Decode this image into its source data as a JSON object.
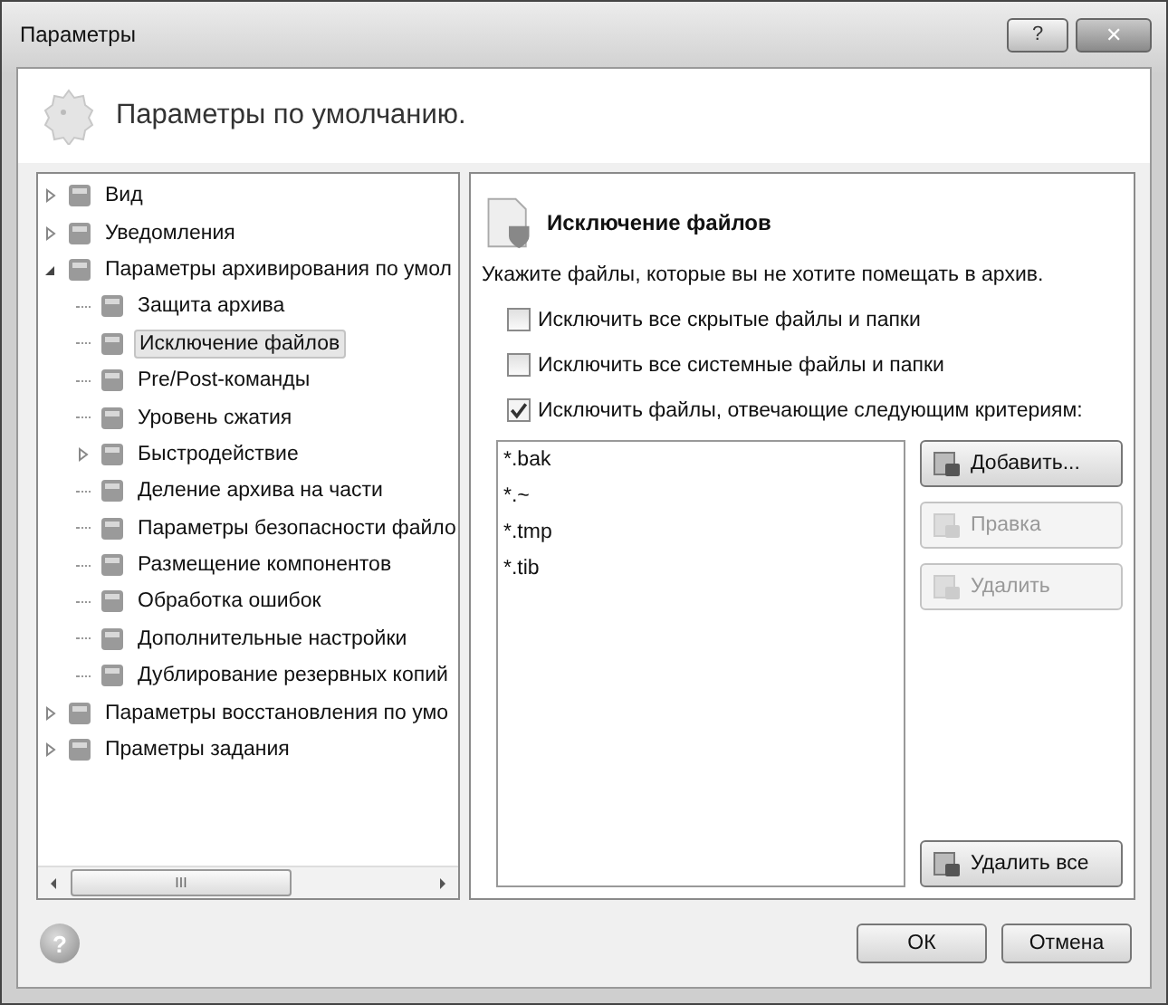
{
  "window": {
    "title": "Параметры",
    "help_button": "?",
    "close_button": "✕"
  },
  "header": {
    "title": "Параметры по умолчанию."
  },
  "tree": [
    {
      "label": "Вид",
      "expanded": false,
      "selected": false
    },
    {
      "label": "Уведомления",
      "expanded": false,
      "selected": false
    },
    {
      "label": "Параметры архивирования по умол",
      "expanded": true,
      "selected": false,
      "children": [
        {
          "label": "Защита архива",
          "selected": false
        },
        {
          "label": "Исключение файлов",
          "selected": true
        },
        {
          "label": "Pre/Post-команды",
          "selected": false
        },
        {
          "label": "Уровень сжатия",
          "selected": false
        },
        {
          "label": "Быстродействие",
          "expanded": false,
          "selected": false
        },
        {
          "label": "Деление архива на части",
          "selected": false
        },
        {
          "label": "Параметры безопасности файло",
          "selected": false
        },
        {
          "label": "Размещение компонентов",
          "selected": false
        },
        {
          "label": "Обработка ошибок",
          "selected": false
        },
        {
          "label": "Дополнительные настройки",
          "selected": false
        },
        {
          "label": "Дублирование резервных копий",
          "selected": false
        }
      ]
    },
    {
      "label": "Параметры восстановления по умо",
      "expanded": false,
      "selected": false
    },
    {
      "label": "Праметры задания",
      "expanded": false,
      "selected": false
    }
  ],
  "scrollbar_grip": "III",
  "panel": {
    "title": "Исключение файлов",
    "description": "Укажите файлы, которые вы не хотите помещать в архив.",
    "options": [
      {
        "label": "Исключить все скрытые файлы и папки",
        "checked": false
      },
      {
        "label": "Исключить все системные файлы и папки",
        "checked": false
      },
      {
        "label": "Исключить файлы, отвечающие следующим критериям:",
        "checked": true
      }
    ],
    "masks": [
      "*.bak",
      "*.~",
      "*.tmp",
      "*.tib"
    ],
    "buttons": [
      {
        "label": "Добавить...",
        "disabled": false
      },
      {
        "label": "Правка",
        "disabled": true
      },
      {
        "label": "Удалить",
        "disabled": true
      },
      {
        "label": "Удалить все",
        "disabled": false
      }
    ]
  },
  "footer": {
    "help": "?",
    "buttons": [
      "ОК",
      "Отмена"
    ]
  }
}
